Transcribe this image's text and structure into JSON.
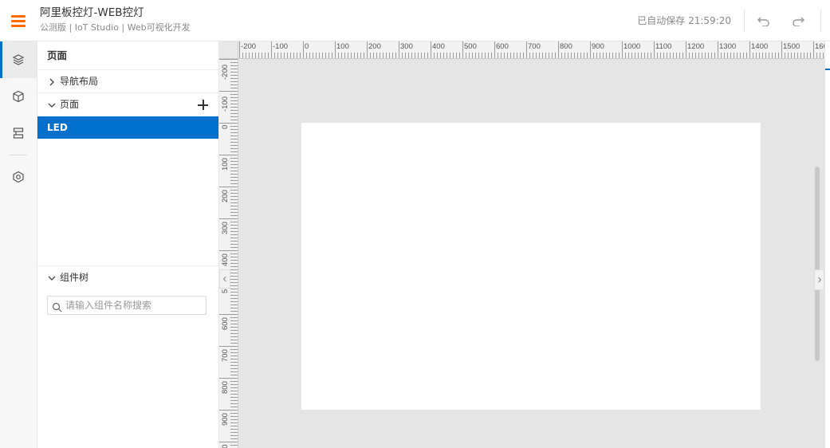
{
  "header": {
    "title": "阿里板控灯-WEB控灯",
    "subtitle": "公测版 | IoT Studio | Web可视化开发",
    "saved_status": "已自动保存 21:59:20"
  },
  "rail": {
    "items": [
      {
        "icon": "layers-icon",
        "active": true
      },
      {
        "icon": "cube-icon",
        "active": false
      },
      {
        "icon": "data-source-icon",
        "active": false
      },
      {
        "icon": "settings-hexagon-icon",
        "active": false
      }
    ]
  },
  "panel": {
    "heading": "页面",
    "nav_layout_label": "导航布局",
    "pages_label": "页面",
    "pages": [
      "LED"
    ],
    "component_tree_label": "组件树",
    "search_placeholder": "请输入组件名称搜索"
  },
  "ruler": {
    "horizontal": [
      "-200",
      "-100",
      "0",
      "100",
      "200",
      "300",
      "400",
      "500",
      "600",
      "700",
      "800",
      "900",
      "1000",
      "1100",
      "1200",
      "1300",
      "1400",
      "1500",
      "160"
    ],
    "vertical": [
      "-200",
      "-100",
      "0",
      "100",
      "200",
      "300",
      "400",
      "5(",
      "600",
      "700",
      "800",
      "900",
      "10"
    ]
  },
  "colors": {
    "accent": "#0070cc",
    "menu": "#ff6a00",
    "canvas_bg": "#e5e5e5"
  }
}
